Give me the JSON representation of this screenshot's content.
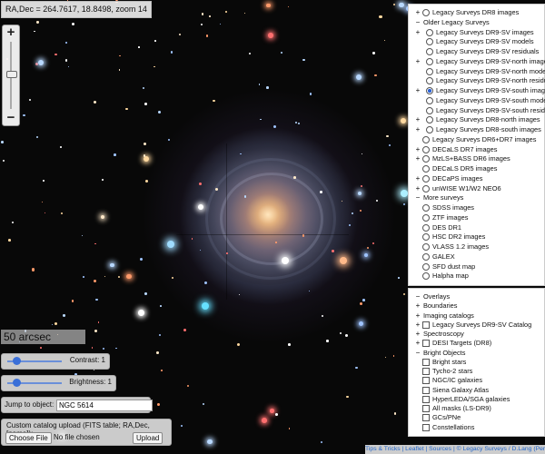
{
  "coords": {
    "text": "RA,Dec = 264.7617, 18.8498, zoom 14"
  },
  "zoom_control": {
    "plus": "+",
    "minus": "−",
    "level": 14
  },
  "scale_bar": {
    "label": "50 arcsec"
  },
  "contrast": {
    "label": "Contrast: 1",
    "value": 1
  },
  "brightness": {
    "label": "Brightness: 1",
    "value": 1
  },
  "jump": {
    "label": "Jump to object:",
    "value": "NGC 5614"
  },
  "catalog_upload": {
    "title": "Custom catalog upload (FITS table; RA,Dec,[name]):",
    "choose_label": "Choose File",
    "no_file": "No file chosen",
    "upload_label": "Upload"
  },
  "layers": {
    "selected": "Legacy Surveys DR9-SV-south images",
    "items": [
      {
        "toggle": "+",
        "type": "radio",
        "label": "Legacy Surveys DR8 images"
      },
      {
        "toggle": "−",
        "type": "none",
        "label": "Older Legacy Surveys"
      },
      {
        "toggle": "+",
        "type": "radio",
        "label": "Legacy Surveys DR9-SV images"
      },
      {
        "toggle": "",
        "type": "radio",
        "label": "Legacy Surveys DR9-SV models"
      },
      {
        "toggle": "",
        "type": "radio",
        "label": "Legacy Surveys DR9-SV residuals"
      },
      {
        "toggle": "+",
        "type": "radio",
        "label": "Legacy Surveys DR9-SV-north images"
      },
      {
        "toggle": "",
        "type": "radio",
        "label": "Legacy Surveys DR9-SV-north models"
      },
      {
        "toggle": "",
        "type": "radio",
        "label": "Legacy Surveys DR9-SV-north residuals"
      },
      {
        "toggle": "+",
        "type": "radio",
        "label": "Legacy Surveys DR9-SV-south images"
      },
      {
        "toggle": "",
        "type": "radio",
        "label": "Legacy Surveys DR9-SV-south models"
      },
      {
        "toggle": "",
        "type": "radio",
        "label": "Legacy Surveys DR9-SV-south residuals"
      },
      {
        "toggle": "+",
        "type": "radio",
        "label": "Legacy Surveys DR8-north images"
      },
      {
        "toggle": "+",
        "type": "radio",
        "label": "Legacy Surveys DR8-south images"
      },
      {
        "toggle": "",
        "type": "radio",
        "label": "Legacy Surveys DR6+DR7 images"
      },
      {
        "toggle": "+",
        "type": "radio",
        "label": "DECaLS DR7 images"
      },
      {
        "toggle": "+",
        "type": "radio",
        "label": "MzLS+BASS DR6 images"
      },
      {
        "toggle": "",
        "type": "radio",
        "label": "DECaLS DR5 images"
      },
      {
        "toggle": "+",
        "type": "radio",
        "label": "DECaPS images"
      },
      {
        "toggle": "+",
        "type": "radio",
        "label": "unWISE W1/W2 NEO6"
      },
      {
        "toggle": "−",
        "type": "none",
        "label": "More surveys"
      },
      {
        "toggle": "",
        "type": "radio",
        "label": "SDSS images"
      },
      {
        "toggle": "",
        "type": "radio",
        "label": "ZTF images"
      },
      {
        "toggle": "",
        "type": "radio",
        "label": "DES DR1"
      },
      {
        "toggle": "",
        "type": "radio",
        "label": "HSC DR2 images"
      },
      {
        "toggle": "",
        "type": "radio",
        "label": "VLASS 1.2 images"
      },
      {
        "toggle": "",
        "type": "radio",
        "label": "GALEX"
      },
      {
        "toggle": "",
        "type": "radio",
        "label": "SFD dust map"
      },
      {
        "toggle": "",
        "type": "radio",
        "label": "Halpha map"
      }
    ]
  },
  "overlays": {
    "items": [
      {
        "toggle": "−",
        "type": "none",
        "label": "Overlays"
      },
      {
        "toggle": "+",
        "type": "none",
        "label": "Boundaries"
      },
      {
        "toggle": "+",
        "type": "none",
        "label": "Imaging catalogs"
      },
      {
        "toggle": "+",
        "type": "check",
        "label": "Legacy Surveys DR9-SV Catalog"
      },
      {
        "toggle": "+",
        "type": "none",
        "label": "Spectroscopy"
      },
      {
        "toggle": "+",
        "type": "check",
        "label": "DESI Targets (DR8)"
      },
      {
        "toggle": "−",
        "type": "none",
        "label": "Bright Objects"
      },
      {
        "toggle": "",
        "type": "check",
        "label": "Bright stars"
      },
      {
        "toggle": "",
        "type": "check",
        "label": "Tycho-2 stars"
      },
      {
        "toggle": "",
        "type": "check",
        "label": "NGC/IC galaxies"
      },
      {
        "toggle": "",
        "type": "check",
        "label": "Siena Galaxy Atlas"
      },
      {
        "toggle": "",
        "type": "check",
        "label": "HyperLEDA/SGA galaxies"
      },
      {
        "toggle": "",
        "type": "check",
        "label": "All masks (LS-DR9)"
      },
      {
        "toggle": "",
        "type": "check",
        "label": "GCs/PNe"
      },
      {
        "toggle": "",
        "type": "check",
        "label": "Constellations"
      }
    ]
  },
  "attribution": {
    "text": "Tips & Tricks | Leaflet | Sources | © Legacy Surveys / D.Lang (Perimeter Institute)"
  }
}
